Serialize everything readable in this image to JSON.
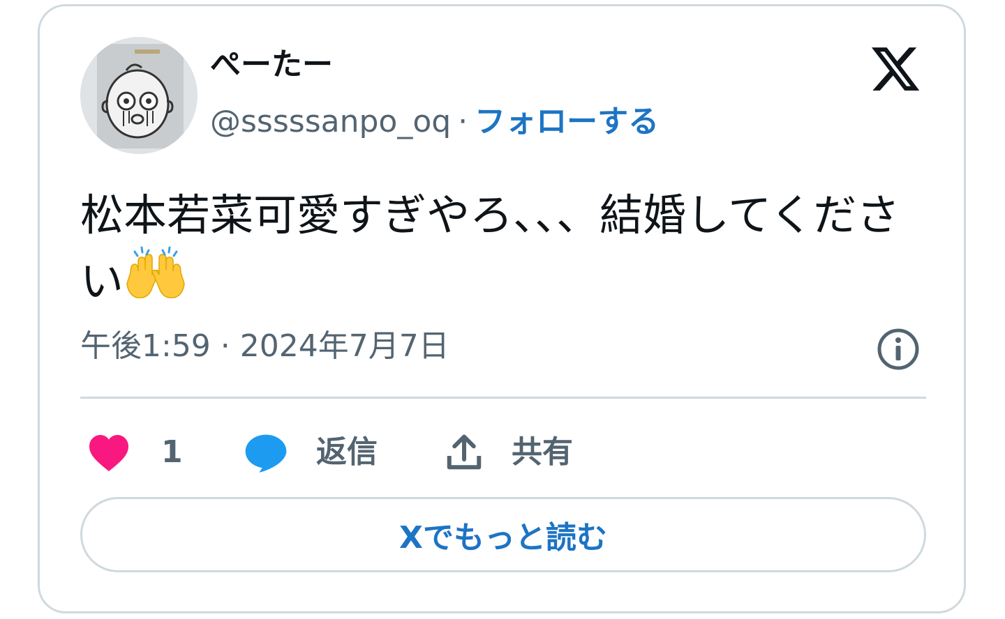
{
  "author": {
    "display_name": "ぺーたー",
    "handle": "@sssssanpo_oq",
    "separator": "·",
    "follow_label": "フォローする"
  },
  "tweet": {
    "text": "松本若菜可愛すぎやろ、、、結婚してください",
    "emoji": "raising-hands",
    "timestamp": "午後1:59 · 2024年7月7日"
  },
  "actions": {
    "like_count": "1",
    "reply_label": "返信",
    "share_label": "共有"
  },
  "read_more_label": "Xでもっと読む",
  "colors": {
    "accent": "#1d74c4",
    "like": "#f91880",
    "reply": "#1d9bf0",
    "muted": "#536471",
    "border": "#cfd9de"
  }
}
